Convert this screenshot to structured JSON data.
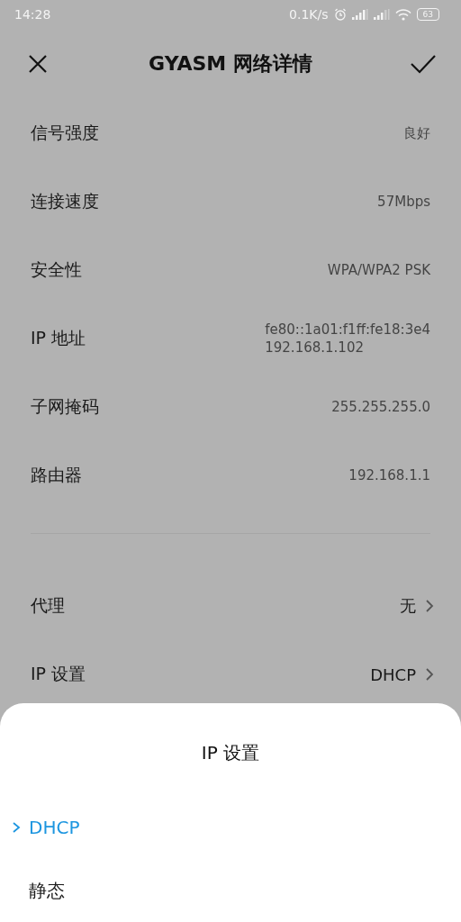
{
  "status_bar": {
    "time": "14:28",
    "speed": "0.1K/s",
    "battery": "63"
  },
  "header": {
    "title": "GYASM 网络详情"
  },
  "details": [
    {
      "label": "信号强度",
      "values": [
        "良好"
      ]
    },
    {
      "label": "连接速度",
      "values": [
        "57Mbps"
      ]
    },
    {
      "label": "安全性",
      "values": [
        "WPA/WPA2 PSK"
      ]
    },
    {
      "label": "IP 地址",
      "values": [
        "fe80::1a01:f1ff:fe18:3e4",
        "192.168.1.102"
      ]
    },
    {
      "label": "子网掩码",
      "values": [
        "255.255.255.0"
      ]
    },
    {
      "label": "路由器",
      "values": [
        "192.168.1.1"
      ]
    }
  ],
  "settings": [
    {
      "label": "代理",
      "value": "无"
    },
    {
      "label": "IP 设置",
      "value": "DHCP"
    }
  ],
  "sheet": {
    "title": "IP 设置",
    "options": [
      {
        "label": "DHCP",
        "selected": true
      },
      {
        "label": "静态",
        "selected": false
      }
    ]
  }
}
